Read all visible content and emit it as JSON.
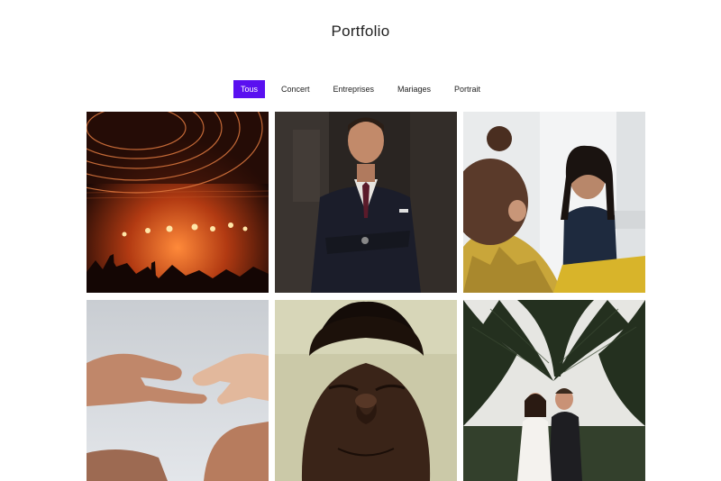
{
  "page": {
    "title": "Portfolio"
  },
  "filters": [
    {
      "label": "Tous",
      "active": true
    },
    {
      "label": "Concert",
      "active": false
    },
    {
      "label": "Entreprises",
      "active": false
    },
    {
      "label": "Mariages",
      "active": false
    },
    {
      "label": "Portrait",
      "active": false
    }
  ],
  "colors": {
    "accent": "#5a10f0",
    "text": "#222222",
    "background": "#ffffff"
  },
  "gallery": [
    {
      "subject": "concert stage lights"
    },
    {
      "subject": "businessman in suit"
    },
    {
      "subject": "smiling woman at meeting"
    },
    {
      "subject": "reaching hands"
    },
    {
      "subject": "man with closed eyes portrait"
    },
    {
      "subject": "wedding couple under palm trees"
    }
  ]
}
